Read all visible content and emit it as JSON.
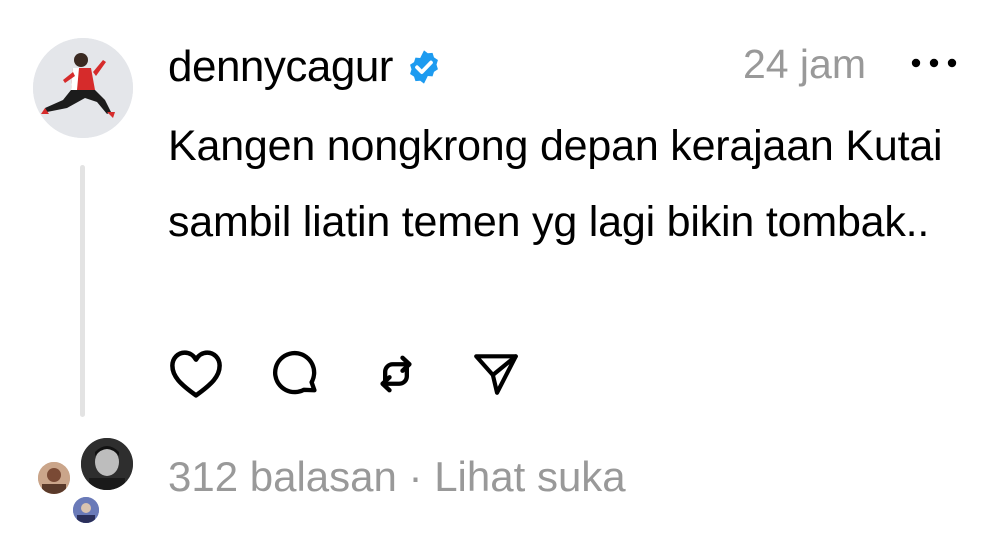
{
  "post": {
    "username": "dennycagur",
    "timestamp": "24 jam",
    "text": "Kangen nongkrong depan kerajaan Kutai sambil liatin temen yg lagi bikin tombak..",
    "verified": true
  },
  "stats": {
    "replies": "312 balasan",
    "separator": " · ",
    "likes_link": "Lihat suka"
  },
  "icons": {
    "more": "more-horizontal-icon",
    "like": "heart-icon",
    "reply": "comment-icon",
    "repost": "repost-icon",
    "share": "send-icon",
    "verified": "verified-badge-icon"
  },
  "colors": {
    "verified_badge": "#1d9bf0",
    "muted_text": "#999999",
    "thread_line": "#e3e3e3"
  }
}
